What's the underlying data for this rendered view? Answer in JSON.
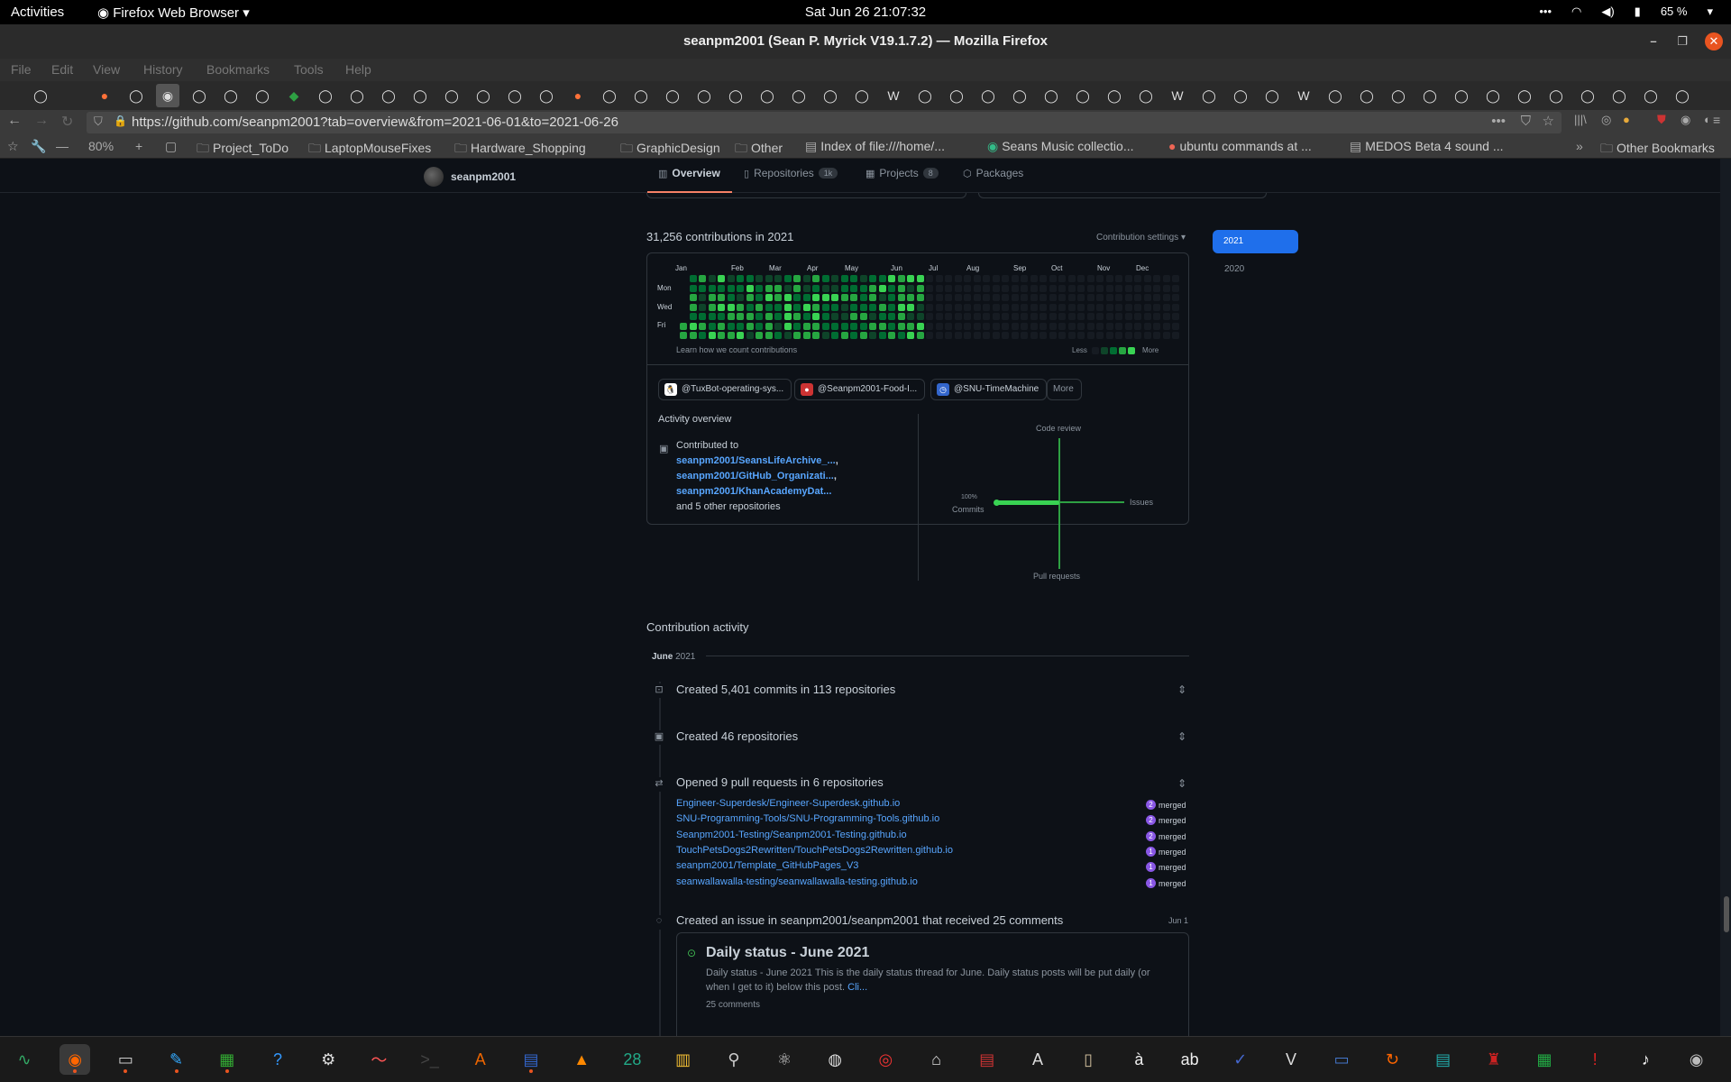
{
  "topbar": {
    "activities": "Activities",
    "app_menu": "Firefox Web Browser",
    "clock": "Sat Jun 26  21:07:32",
    "battery": "65 %"
  },
  "window": {
    "title": "seanpm2001 (Sean P. Myrick V19.1.7.2) — Mozilla Firefox"
  },
  "menubar": [
    "File",
    "Edit",
    "View",
    "History",
    "Bookmarks",
    "Tools",
    "Help"
  ],
  "navbar": {
    "url": "https://github.com/seanpm2001?tab=overview&from=2021-06-01&to=2021-06-26",
    "zoom": "80%"
  },
  "bookmarks": [
    {
      "label": "Project_ToDo",
      "icon": "folder-icon"
    },
    {
      "label": "LaptopMouseFixes",
      "icon": "folder-icon"
    },
    {
      "label": "Hardware_Shopping",
      "icon": "folder-icon"
    },
    {
      "label": "GraphicDesign",
      "icon": "folder-icon"
    },
    {
      "label": "Other",
      "icon": "folder-icon"
    },
    {
      "label": "Index of file:///home/...",
      "icon": "page-icon"
    },
    {
      "label": "Seans Music collectio...",
      "icon": "globe-icon"
    },
    {
      "label": "ubuntu commands at ...",
      "icon": "duckduckgo-icon"
    },
    {
      "label": "MEDOS Beta 4 sound ...",
      "icon": "page-icon"
    },
    {
      "label": "Other Bookmarks",
      "icon": "folder-icon"
    }
  ],
  "github": {
    "username": "seanpm2001",
    "tabs": [
      {
        "label": "Overview",
        "count": ""
      },
      {
        "label": "Repositories",
        "count": "1k"
      },
      {
        "label": "Projects",
        "count": "8"
      },
      {
        "label": "Packages",
        "count": ""
      }
    ],
    "contrib_heading": "31,256 contributions in 2021",
    "contrib_settings": "Contribution settings ▾",
    "years": [
      "2021",
      "2020"
    ],
    "months": [
      "Jan",
      "Feb",
      "Mar",
      "Apr",
      "May",
      "Jun",
      "Jul",
      "Aug",
      "Sep",
      "Oct",
      "Nov",
      "Dec"
    ],
    "days": [
      "Mon",
      "Wed",
      "Fri"
    ],
    "learn_link": "Learn how we count contributions",
    "legend_less": "Less",
    "legend_more": "More",
    "legend_colors": [
      "#161b22",
      "#0e4429",
      "#006d32",
      "#26a641",
      "#39d353"
    ],
    "orgs": [
      "@TuxBot-operating-sys...",
      "@Seanpm2001-Food-I...",
      "@SNU-TimeMachine"
    ],
    "orgs_more": "More",
    "activity_overview": {
      "title": "Activity overview",
      "contributed_to": "Contributed to",
      "repos": [
        "seanpm2001/SeansLifeArchive_...",
        "seanpm2001/GitHub_Organizati...",
        "seanpm2001/KhanAcademyDat..."
      ],
      "other": "and 5 other repositories",
      "axes": {
        "top": "Code review",
        "right": "Issues",
        "bottom": "Pull requests",
        "left_pct": "100%",
        "left": "Commits"
      },
      "percentages": {
        "commits": 100,
        "issues": 0,
        "code_review": 0,
        "pull_requests": 0
      }
    },
    "contribution_activity": {
      "title": "Contribution activity",
      "month": "June",
      "year": "2021",
      "items": [
        {
          "text": "Created 5,401 commits in 113 repositories"
        },
        {
          "text": "Created 46 repositories"
        },
        {
          "text": "Opened 9 pull requests in 6 repositories"
        }
      ],
      "pull_requests": [
        {
          "repo": "Engineer-Superdesk/Engineer-Superdesk.github.io",
          "count": "2",
          "status": "merged"
        },
        {
          "repo": "SNU-Programming-Tools/SNU-Programming-Tools.github.io",
          "count": "2",
          "status": "merged"
        },
        {
          "repo": "Seanpm2001-Testing/Seanpm2001-Testing.github.io",
          "count": "2",
          "status": "merged"
        },
        {
          "repo": "TouchPetsDogs2Rewritten/TouchPetsDogs2Rewritten.github.io",
          "count": "1",
          "status": "merged"
        },
        {
          "repo": "seanpm2001/Template_GitHubPages_V3",
          "count": "1",
          "status": "merged"
        },
        {
          "repo": "seanwallawalla-testing/seanwallawalla-testing.github.io",
          "count": "1",
          "status": "merged"
        }
      ],
      "issue": {
        "text": "Created an issue in seanpm2001/seanpm2001 that received 25 comments",
        "date": "Jun 1",
        "title": "Daily status - June 2021",
        "body": "Daily status - June 2021 This is the daily status thread for June. Daily status posts will be put daily (or when I get to it) below this post.",
        "more": "Cli...",
        "comments": "25 comments"
      }
    }
  },
  "taskbar": [
    "system-monitor-icon",
    "firefox-icon",
    "files-icon",
    "text-editor-icon",
    "calculator-plus-icon",
    "help-icon",
    "settings-icon",
    "waveform-icon",
    "terminal-icon",
    "software-center-icon",
    "document-viewer-icon",
    "vlc-icon",
    "calendar-icon",
    "calculator-icon",
    "search-icon",
    "atom-icon",
    "disk-icon",
    "chrome-icon",
    "glade-icon",
    "doc-icon",
    "font-icon",
    "archive-icon",
    "character-icon",
    "dictionary-icon",
    "checklist-icon",
    "vim-icon",
    "screenshot-icon",
    "update-icon",
    "book-icon",
    "mario-icon",
    "spreadsheet-icon",
    "alert-icon",
    "music-icon",
    "webcam-icon",
    "app-grid-icon"
  ]
}
